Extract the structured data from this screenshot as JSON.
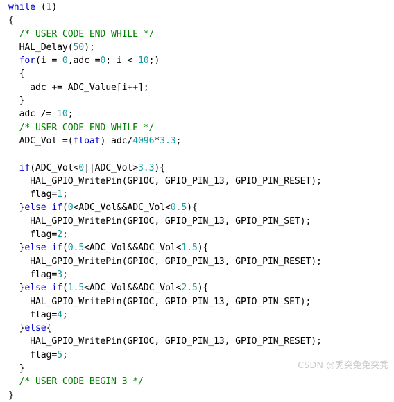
{
  "editor": {
    "language": "c",
    "background_color": "#ffffff",
    "colors": {
      "keyword": "#0000d0",
      "number": "#0f9b9b",
      "comment": "#008000",
      "plain": "#000000",
      "watermark": "#c9c9c9"
    },
    "lines": [
      {
        "indent": 0,
        "tokens": [
          {
            "t": "kw",
            "v": "while"
          },
          {
            "t": "plain",
            "v": " ("
          },
          {
            "t": "num",
            "v": "1"
          },
          {
            "t": "plain",
            "v": ")"
          }
        ]
      },
      {
        "indent": 0,
        "tokens": [
          {
            "t": "plain",
            "v": "{"
          }
        ]
      },
      {
        "indent": 1,
        "tokens": [
          {
            "t": "cmt",
            "v": "/* USER CODE END WHILE */"
          }
        ]
      },
      {
        "indent": 1,
        "tokens": [
          {
            "t": "plain",
            "v": "HAL_Delay("
          },
          {
            "t": "num",
            "v": "50"
          },
          {
            "t": "plain",
            "v": ");"
          }
        ]
      },
      {
        "indent": 1,
        "tokens": [
          {
            "t": "kw",
            "v": "for"
          },
          {
            "t": "plain",
            "v": "(i = "
          },
          {
            "t": "num",
            "v": "0"
          },
          {
            "t": "plain",
            "v": ",adc ="
          },
          {
            "t": "num",
            "v": "0"
          },
          {
            "t": "plain",
            "v": "; i < "
          },
          {
            "t": "num",
            "v": "10"
          },
          {
            "t": "plain",
            "v": ";)"
          }
        ]
      },
      {
        "indent": 1,
        "tokens": [
          {
            "t": "plain",
            "v": "{"
          }
        ]
      },
      {
        "indent": 2,
        "tokens": [
          {
            "t": "plain",
            "v": "adc += ADC_Value[i++];"
          }
        ]
      },
      {
        "indent": 1,
        "tokens": [
          {
            "t": "plain",
            "v": "}"
          }
        ]
      },
      {
        "indent": 1,
        "tokens": [
          {
            "t": "plain",
            "v": "adc /= "
          },
          {
            "t": "num",
            "v": "10"
          },
          {
            "t": "plain",
            "v": ";"
          }
        ]
      },
      {
        "indent": 1,
        "tokens": [
          {
            "t": "cmt",
            "v": "/* USER CODE END WHILE */"
          }
        ]
      },
      {
        "indent": 1,
        "tokens": [
          {
            "t": "plain",
            "v": "ADC_Vol =("
          },
          {
            "t": "kw",
            "v": "float"
          },
          {
            "t": "plain",
            "v": ") adc/"
          },
          {
            "t": "num",
            "v": "4096"
          },
          {
            "t": "plain",
            "v": "*"
          },
          {
            "t": "num",
            "v": "3.3"
          },
          {
            "t": "plain",
            "v": ";"
          }
        ]
      },
      {
        "indent": 0,
        "tokens": [
          {
            "t": "plain",
            "v": ""
          }
        ]
      },
      {
        "indent": 1,
        "tokens": [
          {
            "t": "kw",
            "v": "if"
          },
          {
            "t": "plain",
            "v": "(ADC_Vol<"
          },
          {
            "t": "num",
            "v": "0"
          },
          {
            "t": "plain",
            "v": "||ADC_Vol>"
          },
          {
            "t": "num",
            "v": "3.3"
          },
          {
            "t": "plain",
            "v": "){"
          }
        ]
      },
      {
        "indent": 2,
        "tokens": [
          {
            "t": "plain",
            "v": "HAL_GPIO_WritePin(GPIOC, GPIO_PIN_13, GPIO_PIN_RESET);"
          }
        ]
      },
      {
        "indent": 2,
        "tokens": [
          {
            "t": "plain",
            "v": "flag="
          },
          {
            "t": "num",
            "v": "1"
          },
          {
            "t": "plain",
            "v": ";"
          }
        ]
      },
      {
        "indent": 1,
        "tokens": [
          {
            "t": "plain",
            "v": "}"
          },
          {
            "t": "kw",
            "v": "else"
          },
          {
            "t": "plain",
            "v": " "
          },
          {
            "t": "kw",
            "v": "if"
          },
          {
            "t": "plain",
            "v": "("
          },
          {
            "t": "num",
            "v": "0"
          },
          {
            "t": "plain",
            "v": "<ADC_Vol&&ADC_Vol<"
          },
          {
            "t": "num",
            "v": "0.5"
          },
          {
            "t": "plain",
            "v": "){"
          }
        ]
      },
      {
        "indent": 2,
        "tokens": [
          {
            "t": "plain",
            "v": "HAL_GPIO_WritePin(GPIOC, GPIO_PIN_13, GPIO_PIN_SET);"
          }
        ]
      },
      {
        "indent": 2,
        "tokens": [
          {
            "t": "plain",
            "v": "flag="
          },
          {
            "t": "num",
            "v": "2"
          },
          {
            "t": "plain",
            "v": ";"
          }
        ]
      },
      {
        "indent": 1,
        "tokens": [
          {
            "t": "plain",
            "v": "}"
          },
          {
            "t": "kw",
            "v": "else"
          },
          {
            "t": "plain",
            "v": " "
          },
          {
            "t": "kw",
            "v": "if"
          },
          {
            "t": "plain",
            "v": "("
          },
          {
            "t": "num",
            "v": "0.5"
          },
          {
            "t": "plain",
            "v": "<ADC_Vol&&ADC_Vol<"
          },
          {
            "t": "num",
            "v": "1.5"
          },
          {
            "t": "plain",
            "v": "){"
          }
        ]
      },
      {
        "indent": 2,
        "tokens": [
          {
            "t": "plain",
            "v": "HAL_GPIO_WritePin(GPIOC, GPIO_PIN_13, GPIO_PIN_RESET);"
          }
        ]
      },
      {
        "indent": 2,
        "tokens": [
          {
            "t": "plain",
            "v": "flag="
          },
          {
            "t": "num",
            "v": "3"
          },
          {
            "t": "plain",
            "v": ";"
          }
        ]
      },
      {
        "indent": 1,
        "tokens": [
          {
            "t": "plain",
            "v": "}"
          },
          {
            "t": "kw",
            "v": "else"
          },
          {
            "t": "plain",
            "v": " "
          },
          {
            "t": "kw",
            "v": "if"
          },
          {
            "t": "plain",
            "v": "("
          },
          {
            "t": "num",
            "v": "1.5"
          },
          {
            "t": "plain",
            "v": "<ADC_Vol&&ADC_Vol<"
          },
          {
            "t": "num",
            "v": "2.5"
          },
          {
            "t": "plain",
            "v": "){"
          }
        ]
      },
      {
        "indent": 2,
        "tokens": [
          {
            "t": "plain",
            "v": "HAL_GPIO_WritePin(GPIOC, GPIO_PIN_13, GPIO_PIN_SET);"
          }
        ]
      },
      {
        "indent": 2,
        "tokens": [
          {
            "t": "plain",
            "v": "flag="
          },
          {
            "t": "num",
            "v": "4"
          },
          {
            "t": "plain",
            "v": ";"
          }
        ]
      },
      {
        "indent": 1,
        "tokens": [
          {
            "t": "plain",
            "v": "}"
          },
          {
            "t": "kw",
            "v": "else"
          },
          {
            "t": "plain",
            "v": "{"
          }
        ]
      },
      {
        "indent": 2,
        "tokens": [
          {
            "t": "plain",
            "v": "HAL_GPIO_WritePin(GPIOC, GPIO_PIN_13, GPIO_PIN_RESET);"
          }
        ]
      },
      {
        "indent": 2,
        "tokens": [
          {
            "t": "plain",
            "v": "flag="
          },
          {
            "t": "num",
            "v": "5"
          },
          {
            "t": "plain",
            "v": ";"
          }
        ]
      },
      {
        "indent": 1,
        "tokens": [
          {
            "t": "plain",
            "v": "}"
          }
        ]
      },
      {
        "indent": 1,
        "tokens": [
          {
            "t": "cmt",
            "v": "/* USER CODE BEGIN 3 */"
          }
        ]
      },
      {
        "indent": 0,
        "tokens": [
          {
            "t": "plain",
            "v": "}"
          }
        ]
      }
    ]
  },
  "watermark": {
    "text": "CSDN @秃突兔兔突秃"
  }
}
